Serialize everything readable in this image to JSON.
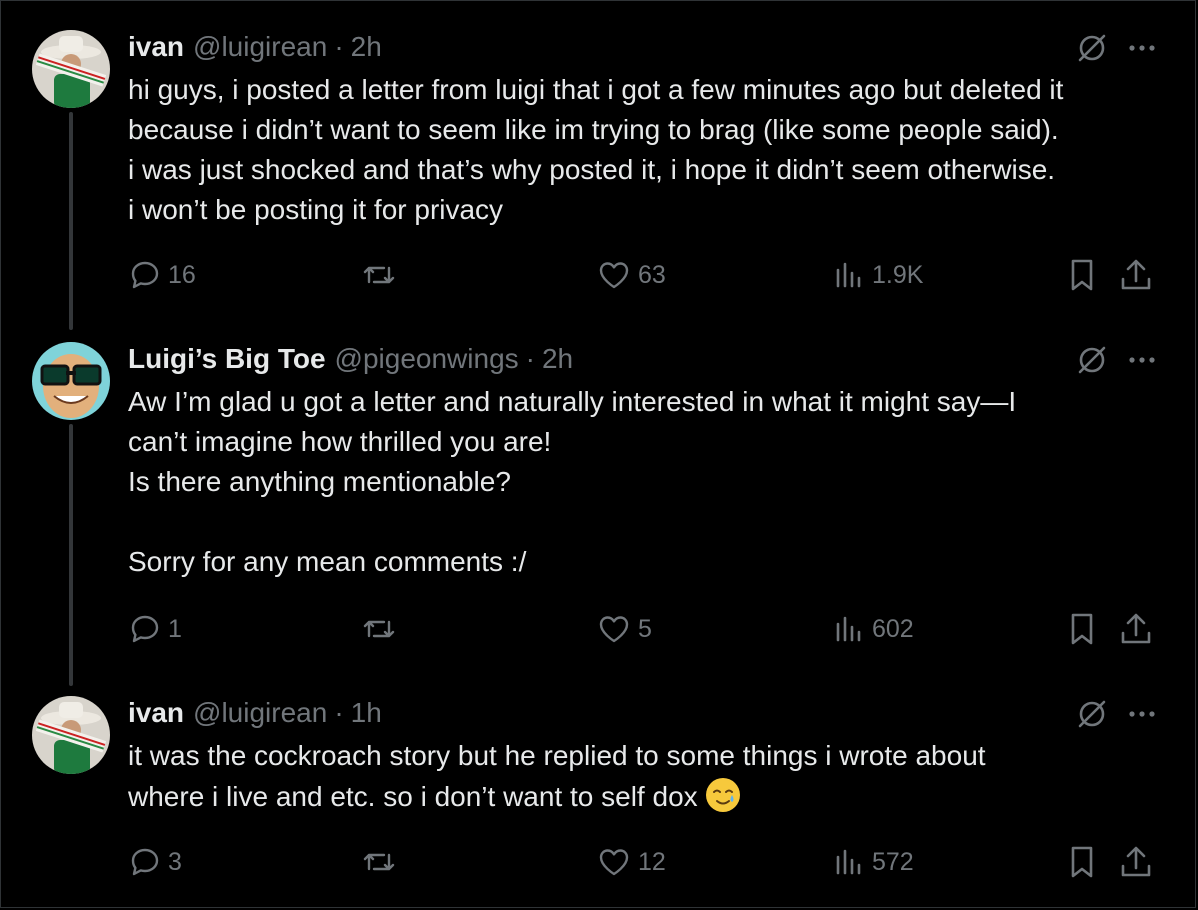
{
  "tweets": [
    {
      "name": "ivan",
      "handle": "@luigirean",
      "sep": "·",
      "time": "2h",
      "text": "hi guys, i posted a letter from luigi that i got a few minutes ago but deleted it\nbecause i didn’t want to seem like im trying to brag (like some people said).\ni was just shocked and that’s why posted it, i hope it didn’t seem otherwise.\ni won’t be posting it for privacy",
      "replies": "16",
      "retweets": "",
      "likes": "63",
      "views": "1.9K",
      "avatar_icon": "cowboy-hat-avatar"
    },
    {
      "name": "Luigi’s Big Toe",
      "handle": "@pigeonwings",
      "sep": "·",
      "time": "2h",
      "text": "Aw I’m glad u got a letter and naturally interested in what it might say—I\ncan’t imagine how thrilled you are!\nIs there anything mentionable?\n\nSorry for any mean comments :/",
      "replies": "1",
      "retweets": "",
      "likes": "5",
      "views": "602",
      "avatar_icon": "sunglasses-face-avatar"
    },
    {
      "name": "ivan",
      "handle": "@luigirean",
      "sep": "·",
      "time": "1h",
      "text": "it was the cockroach story but he replied to some things i wrote about\nwhere i live and etc. so i don’t want to self dox",
      "emoji": "smiling-face-with-tear",
      "replies": "3",
      "retweets": "",
      "likes": "12",
      "views": "572",
      "avatar_icon": "cowboy-hat-avatar"
    }
  ],
  "icons": {
    "reply": "reply-icon",
    "retweet": "retweet-icon",
    "like": "heart-icon",
    "views": "views-icon",
    "bookmark": "bookmark-icon",
    "share": "share-icon",
    "grok": "grok-icon",
    "more": "more-icon"
  },
  "colors": {
    "background": "#000000",
    "text": "#e7e9ea",
    "muted": "#71767b",
    "thread_line": "#333639"
  }
}
